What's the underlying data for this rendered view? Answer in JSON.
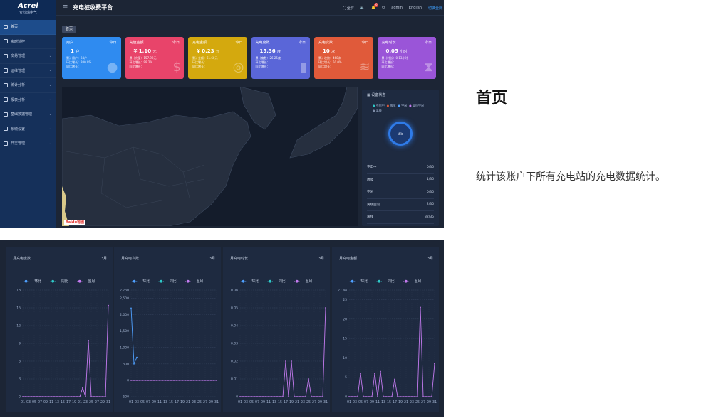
{
  "app": {
    "brand": "Acrel",
    "brand_sub": "安科瑞电气",
    "title": "充电桩收费平台"
  },
  "topbar": {
    "fullscreen": "全屏",
    "notify_count": "6",
    "user": "admin",
    "lang": "English",
    "link": "切换全屏"
  },
  "sidebar": {
    "items": [
      {
        "label": "首页",
        "active": true,
        "arrow": false
      },
      {
        "label": "实时监控",
        "arrow": false
      },
      {
        "label": "交易管理",
        "arrow": true
      },
      {
        "label": "运维管理",
        "arrow": true
      },
      {
        "label": "统计分析",
        "arrow": true
      },
      {
        "label": "报表分析",
        "arrow": true
      },
      {
        "label": "基础数据管理",
        "arrow": true
      },
      {
        "label": "系统设置",
        "arrow": true
      },
      {
        "label": "日志管理",
        "arrow": true
      }
    ]
  },
  "tab": "首页",
  "cards": [
    {
      "title": "用户",
      "period": "今日",
      "value": "1",
      "unit": "户",
      "lines": [
        "累计用户：24户",
        "环比增长：200.0%",
        "同比增长："
      ],
      "color": "#2f8bf0",
      "icon": "user-icon"
    },
    {
      "title": "充值金额",
      "period": "今日",
      "value": "¥ 1.10",
      "unit": "元",
      "lines": [
        "累计充值：157.92元",
        "环比增长：99.2%",
        "同比增长："
      ],
      "color": "#e8446a",
      "icon": "money-bag-icon"
    },
    {
      "title": "充电金额",
      "period": "今日",
      "value": "¥ 0.23",
      "unit": "元",
      "lines": [
        "累计金额：61.60元",
        "环比增长：",
        "同比增长："
      ],
      "color": "#d4a90e",
      "icon": "coin-icon"
    },
    {
      "title": "充电度数",
      "period": "今日",
      "value": "15.36",
      "unit": "度",
      "lines": [
        "累计度数：26.25度",
        "环比增长：",
        "同比增长："
      ],
      "color": "#5a66d8",
      "icon": "plug-icon"
    },
    {
      "title": "充电次数",
      "period": "今日",
      "value": "10",
      "unit": "次",
      "lines": [
        "累计次数：468次",
        "环比增长：50.0%",
        "同比增长："
      ],
      "color": "#e05a3a",
      "icon": "stack-icon"
    },
    {
      "title": "充电时长",
      "period": "今日",
      "value": "0.05",
      "unit": "小时",
      "lines": [
        "累计时长：0.13小时",
        "环比增长：",
        "同比增长："
      ],
      "color": "#9a55d8",
      "icon": "hourglass-icon"
    }
  ],
  "map": {
    "logo": "Baidu地图"
  },
  "device": {
    "title": "设备状态",
    "legend": [
      "充电中",
      "故障",
      "空闲",
      "离线空闲",
      "离线"
    ],
    "gauge": "35",
    "rows": [
      {
        "k": "充电中",
        "v": "0/35"
      },
      {
        "k": "故障",
        "v": "1/35"
      },
      {
        "k": "空闲",
        "v": "0/35"
      },
      {
        "k": "离线空闲",
        "v": "2/35"
      },
      {
        "k": "离线",
        "v": "32/35"
      }
    ]
  },
  "section": {
    "title": "首页",
    "desc": "统计该账户下所有充电站的充电数据统计。"
  },
  "chart_data": [
    {
      "type": "line",
      "title": "月充电度数",
      "month": "3月",
      "legend": [
        "环比",
        "同比",
        "当月"
      ],
      "ylim": [
        0,
        18
      ],
      "yticks": [
        "18",
        "15",
        "12",
        "9",
        "6",
        "3",
        "0"
      ],
      "xticks": [
        "01",
        "03",
        "05",
        "07",
        "09",
        "11",
        "13",
        "15",
        "17",
        "19",
        "21",
        "23",
        "25",
        "27",
        "29",
        "31"
      ],
      "series": [
        {
          "name": "当月",
          "values": [
            0,
            0,
            0,
            0,
            0,
            0,
            0,
            0,
            0,
            0,
            0,
            0,
            0,
            0,
            0,
            0,
            0,
            0,
            0,
            0,
            0,
            1.5,
            0,
            9.5,
            0,
            0,
            0,
            0,
            0,
            0,
            15.4
          ]
        }
      ],
      "colors": [
        "#4fa0ff",
        "#2fc7c7",
        "#c47bf0"
      ]
    },
    {
      "type": "line",
      "title": "月充电次数",
      "month": "3月",
      "legend": [
        "环比",
        "同比",
        "当月"
      ],
      "ylim": [
        -500,
        2750
      ],
      "yticks": [
        "2,750",
        "2,500",
        "2,000",
        "1,500",
        "1,000",
        "500",
        "0",
        "-500"
      ],
      "xticks": [
        "01",
        "03",
        "05",
        "07",
        "09",
        "11",
        "13",
        "15",
        "17",
        "19",
        "21",
        "23",
        "25",
        "27",
        "29",
        "31"
      ],
      "series": [
        {
          "name": "环比",
          "values": [
            2200,
            500,
            700
          ]
        },
        {
          "name": "当月",
          "values": [
            0,
            0,
            0,
            0,
            0,
            0,
            0,
            0,
            0,
            0,
            0,
            0,
            0,
            0,
            0,
            0,
            0,
            0,
            0,
            0,
            0,
            0,
            0,
            0,
            0,
            0,
            0,
            0,
            0,
            0,
            0
          ]
        }
      ],
      "colors": [
        "#4fa0ff",
        "#2fc7c7",
        "#c47bf0"
      ]
    },
    {
      "type": "line",
      "title": "月充电时长",
      "month": "3月",
      "legend": [
        "环比",
        "同比",
        "当月"
      ],
      "ylim": [
        0,
        0.06
      ],
      "yticks": [
        "0.06",
        "0.05",
        "0.04",
        "0.03",
        "0.02",
        "0.01",
        "0"
      ],
      "xticks": [
        "01",
        "03",
        "05",
        "07",
        "09",
        "11",
        "13",
        "15",
        "17",
        "19",
        "21",
        "23",
        "25",
        "27",
        "29",
        "31"
      ],
      "series": [
        {
          "name": "当月",
          "values": [
            0,
            0,
            0,
            0,
            0,
            0,
            0,
            0,
            0,
            0,
            0,
            0,
            0,
            0,
            0,
            0,
            0.02,
            0,
            0.02,
            0,
            0,
            0,
            0,
            0,
            0.01,
            0,
            0,
            0,
            0,
            0,
            0.05
          ]
        }
      ],
      "colors": [
        "#4fa0ff",
        "#2fc7c7",
        "#c47bf0"
      ]
    },
    {
      "type": "line",
      "title": "月充电金额",
      "month": "3月",
      "legend": [
        "环比",
        "同比",
        "当月"
      ],
      "ylim": [
        0,
        27.48
      ],
      "yticks": [
        "27.48",
        "25",
        "20",
        "15",
        "10",
        "5",
        "0"
      ],
      "xticks": [
        "01",
        "03",
        "05",
        "07",
        "09",
        "11",
        "13",
        "15",
        "17",
        "19",
        "21",
        "23",
        "25",
        "27",
        "29",
        "31"
      ],
      "series": [
        {
          "name": "当月",
          "values": [
            0,
            0,
            0,
            0,
            6,
            0,
            0,
            0,
            0,
            6,
            0,
            6.5,
            0,
            0,
            0,
            0,
            4.5,
            0,
            0,
            0,
            0,
            0,
            0,
            0,
            0,
            23,
            0,
            0,
            0,
            0,
            8.5
          ]
        }
      ],
      "colors": [
        "#4fa0ff",
        "#2fc7c7",
        "#c47bf0"
      ]
    }
  ]
}
